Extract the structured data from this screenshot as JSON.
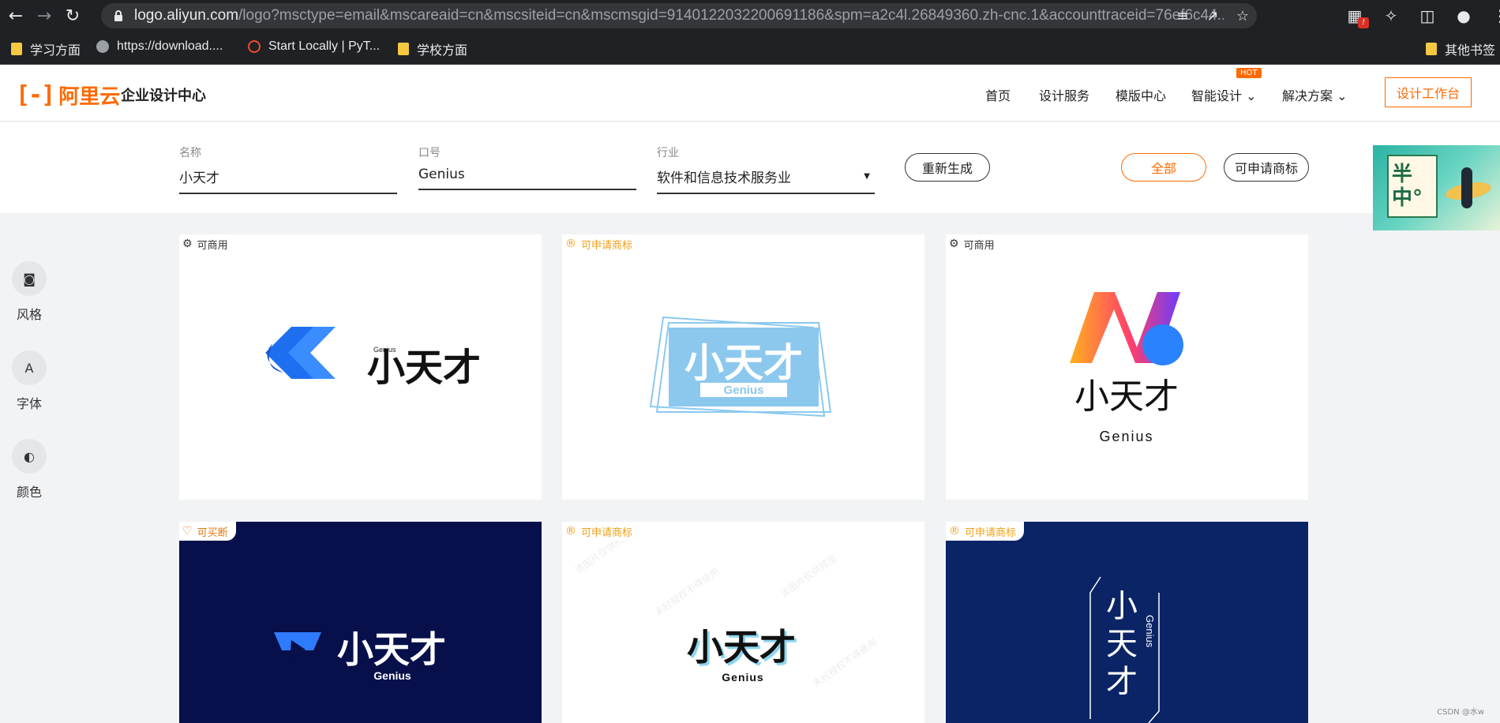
{
  "browser": {
    "url_host": "logo.aliyun.com",
    "url_rest": "/logo?msctype=email&mscareaid=cn&mscsiteid=cn&mscmsgid=9140122032200691186&spm=a2c4l.26849360.zh-cnc.1&accounttraceid=76ef6c44...",
    "bookmarks": [
      {
        "label": "学习方面",
        "icon": "folder-icon"
      },
      {
        "label": "https://download....",
        "icon": "globe-icon"
      },
      {
        "label": "Start Locally | PyT...",
        "icon": "pytorch-icon"
      },
      {
        "label": "学校方面",
        "icon": "folder-icon"
      }
    ],
    "other_bookmarks": "其他书签",
    "extension_badge": "!"
  },
  "header": {
    "logo_mark": "[-]",
    "logo_text": "阿里云",
    "site_title": "企业设计中心",
    "nav": [
      "首页",
      "设计服务",
      "模版中心",
      "智能设计",
      "解决方案"
    ],
    "hot_badge": "HOT",
    "workbench_button": "设计工作台"
  },
  "form": {
    "name_label": "名称",
    "name_value": "小天才",
    "slogan_label": "口号",
    "slogan_value": "Genius",
    "industry_label": "行业",
    "industry_value": "软件和信息技术服务业",
    "regenerate_button": "重新生成",
    "filter_all": "全部",
    "filter_trademark": "可申请商标"
  },
  "ad": {
    "text_line1": "半",
    "text_line2": "中°"
  },
  "sidebar": {
    "tools": [
      {
        "label": "风格",
        "icon": "style-icon",
        "glyph": "◙"
      },
      {
        "label": "字体",
        "icon": "font-icon",
        "glyph": "A"
      },
      {
        "label": "颜色",
        "icon": "palette-icon",
        "glyph": "◐"
      }
    ]
  },
  "cards": [
    {
      "tag": "可商用",
      "tag_icon": "gear-icon",
      "tag_glyph": "⚙",
      "brand": "小天才",
      "slogan": "Genius"
    },
    {
      "tag": "可申请商标",
      "tag_icon": "registered-icon",
      "tag_glyph": "®",
      "brand": "小天才",
      "slogan": "Genius"
    },
    {
      "tag": "可商用",
      "tag_icon": "gear-icon",
      "tag_glyph": "⚙",
      "brand": "小天才",
      "slogan": "Genius"
    },
    {
      "tag": "可买断",
      "tag_icon": "chat-icon",
      "tag_glyph": "♡",
      "brand": "小天才",
      "slogan": "Genius"
    },
    {
      "tag": "可申请商标",
      "tag_icon": "registered-icon",
      "tag_glyph": "®",
      "brand": "小天才",
      "slogan": "Genius"
    },
    {
      "tag": "可申请商标",
      "tag_icon": "registered-icon",
      "tag_glyph": "®",
      "brand": "小天才",
      "slogan": "Genius"
    }
  ],
  "watermark_texts": [
    "该图片仅供预览",
    "未经授权不得使用"
  ],
  "csdn_mark": "CSDN @水w",
  "colors": {
    "accent": "#ff6a00",
    "navy_dark": "#07104a",
    "navy": "#0b2466",
    "light_blue": "#8cc8ee",
    "blue": "#1e6ff0"
  }
}
